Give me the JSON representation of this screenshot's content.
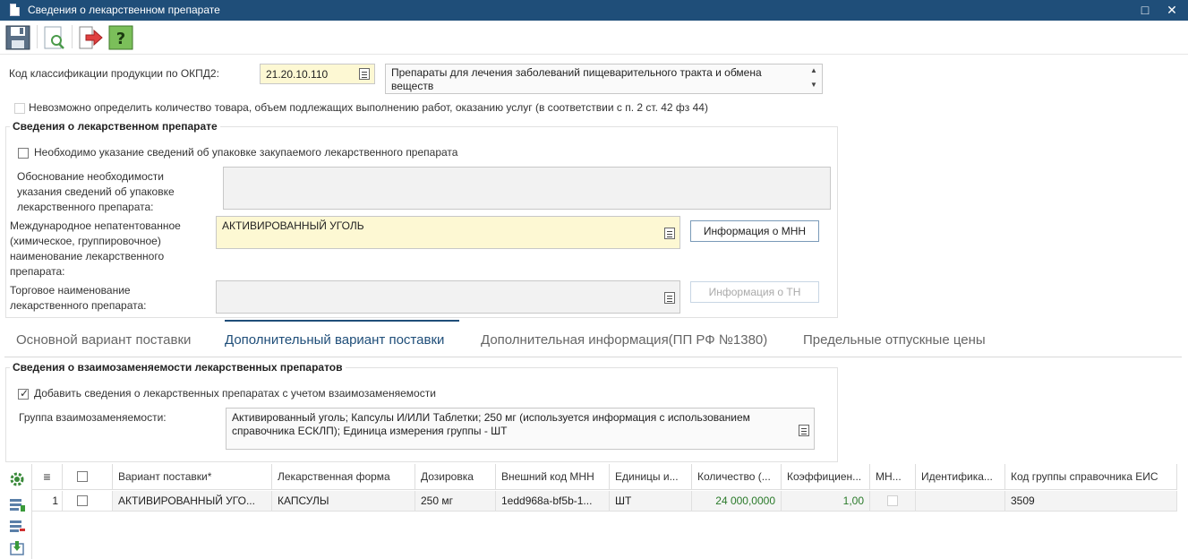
{
  "window": {
    "title": "Сведения о лекарственном препарате",
    "maximize_glyph": "□",
    "close_glyph": "✕"
  },
  "toolbar": {
    "icons": [
      "save-icon",
      "preview-icon",
      "exit-icon",
      "help-icon"
    ],
    "help_glyph": "?"
  },
  "okpd": {
    "label": "Код классификации продукции по ОКПД2:",
    "code": "21.20.10.110",
    "description": "Препараты для лечения заболеваний пищеварительного тракта и обмена веществ"
  },
  "cannot_determine": {
    "label": "Невозможно определить количество товара, объем подлежащих выполнению работ, оказанию услуг (в соответствии с п. 2 ст. 42 фз 44)",
    "checked": false
  },
  "drug_info": {
    "title": "Сведения о лекарственном препарате",
    "packaging_checkbox": {
      "label": "Необходимо указание сведений об упаковке закупаемого лекарственного препарата",
      "checked": false
    },
    "justification_label": "Обоснование необходимости указания сведений об упаковке лекарственного препарата:",
    "justification_value": "",
    "inn_label": "Международное непатентованное (химическое, группировочное) наименование лекарственного препарата:",
    "inn_value": "АКТИВИРОВАННЫЙ УГОЛЬ",
    "inn_button": "Информация о МНН",
    "trade_label": "Торговое наименование лекарственного препарата:",
    "trade_value": "",
    "trade_button": "Информация о ТН"
  },
  "tabs": [
    {
      "label": "Основной вариант поставки",
      "active": false
    },
    {
      "label": "Дополнительный вариант поставки",
      "active": true
    },
    {
      "label": "Дополнительная информация(ПП РФ №1380)",
      "active": false
    },
    {
      "label": "Предельные отпускные цены",
      "active": false
    }
  ],
  "interchange": {
    "title": "Сведения о взаимозаменяемости лекарственных препаратов",
    "add_checkbox": {
      "label": "Добавить сведения о лекарственных препаратах с учетом взаимозаменяемости",
      "checked": true
    },
    "group_label": "Группа взаимозаменяемости:",
    "group_value": "Активированный уголь; Капсулы И/ИЛИ Таблетки; 250 мг (используется информация с использованием справочника ЕСКЛП); Единица измерения группы - ШТ"
  },
  "grid": {
    "headers": [
      "≡",
      "",
      "Вариант поставки*",
      "Лекарственная форма",
      "Дозировка",
      "Внешний код МНН",
      "Единицы и...",
      "Количество (...",
      "Коэффициен...",
      "МН...",
      "Идентифика...",
      "Код группы справочника ЕИС"
    ],
    "rows": [
      {
        "num": "1",
        "selected": false,
        "variant": "АКТИВИРОВАННЫЙ УГО...",
        "form": "КАПСУЛЫ",
        "dosage": "250 мг",
        "ext_code": "1edd968a-bf5b-1...",
        "units": "ШТ",
        "quantity": "24 000,0000",
        "coefficient": "1,00",
        "mn_checked": false,
        "ident": "",
        "group_code": "3509"
      }
    ]
  },
  "side_icons": [
    "settings-gear-icon",
    "add-row-icon",
    "delete-row-icon",
    "import-row-icon"
  ],
  "colors": {
    "titlebar": "#1f4e79",
    "required_field": "#fdf8d3",
    "numeric_text": "#2a7a2a",
    "accent": "#1f4e79"
  }
}
